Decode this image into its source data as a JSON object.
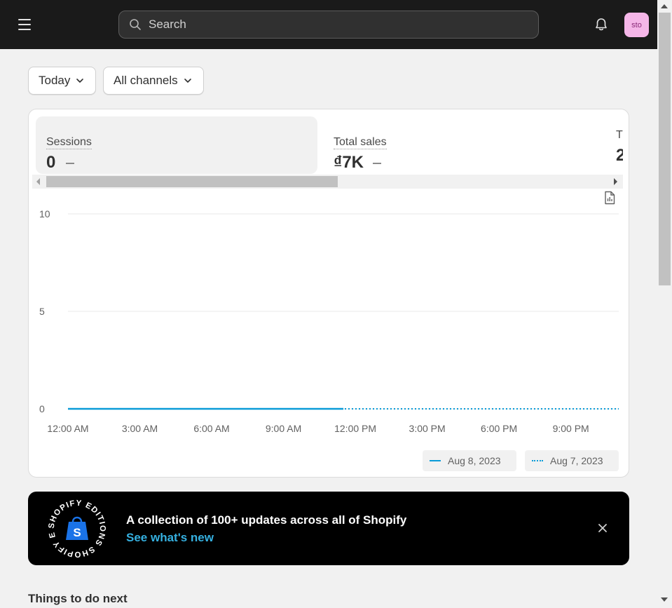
{
  "topbar": {
    "search_placeholder": "Search",
    "avatar_text": "sto"
  },
  "filters": {
    "date_label": "Today",
    "channel_label": "All channels"
  },
  "metrics": [
    {
      "label": "Sessions",
      "value": "0"
    },
    {
      "label": "Total sales",
      "value": "₫7K"
    },
    {
      "label": "T",
      "value": "2"
    }
  ],
  "chart_data": {
    "type": "line",
    "x_labels": [
      "12:00 AM",
      "3:00 AM",
      "6:00 AM",
      "9:00 AM",
      "12:00 PM",
      "3:00 PM",
      "6:00 PM",
      "9:00 PM"
    ],
    "y_ticks": [
      "10",
      "5",
      "0"
    ],
    "ylim": [
      0,
      10
    ],
    "grid": true,
    "series": [
      {
        "name": "Aug 8, 2023",
        "style": "solid",
        "color": "#0a9bd8",
        "x_start": 0,
        "x_end": 11.5,
        "values": [
          0,
          0
        ]
      },
      {
        "name": "Aug 7, 2023",
        "style": "dotted",
        "color": "#0a9bd8",
        "x_start": 0,
        "x_end": 23,
        "values": [
          0,
          0
        ]
      }
    ],
    "legend_placement": "bottom-right"
  },
  "banner": {
    "title": "A collection of 100+ updates across all of Shopify",
    "link": "See what's new",
    "badge_text": "SHOPIFY EDITIONS SHOPIFY EDITIONS",
    "link_color": "#35b0e0"
  },
  "next_section": {
    "title": "Things to do next"
  }
}
